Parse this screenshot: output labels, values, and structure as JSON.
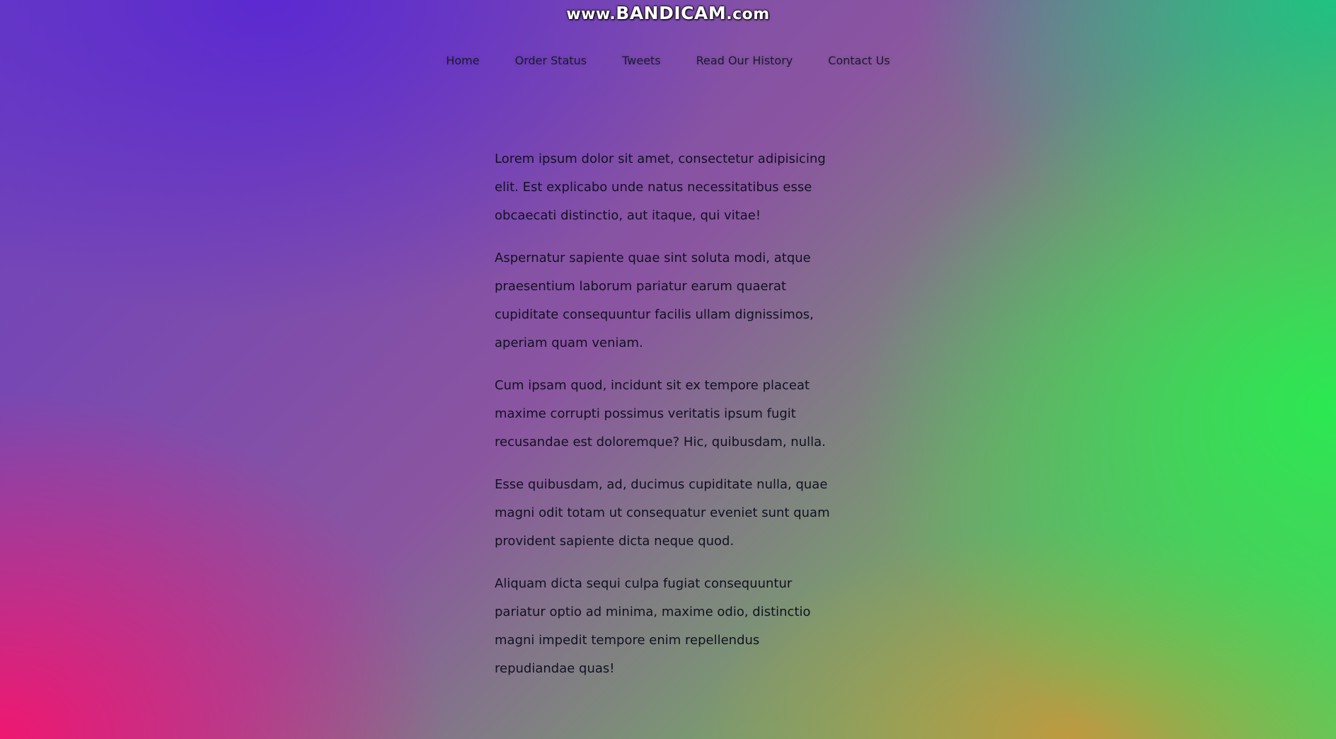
{
  "watermark": {
    "prefix": "www.",
    "brand": "BANDICAM",
    "suffix": ".com"
  },
  "nav": {
    "items": [
      {
        "label": "Home"
      },
      {
        "label": "Order Status"
      },
      {
        "label": "Tweets"
      },
      {
        "label": "Read Our History"
      },
      {
        "label": "Contact Us"
      }
    ]
  },
  "content": {
    "paragraphs": [
      "Lorem ipsum dolor sit amet, consectetur adipisicing elit. Est explicabo unde natus necessitatibus esse obcaecati distinctio, aut itaque, qui vitae!",
      "Aspernatur sapiente quae sint soluta modi, atque praesentium laborum pariatur earum quaerat cupiditate consequuntur facilis ullam dignissimos, aperiam quam veniam.",
      "Cum ipsam quod, incidunt sit ex tempore placeat maxime corrupti possimus veritatis ipsum fugit recusandae est doloremque? Hic, quibusdam, nulla.",
      "Esse quibusdam, ad, ducimus cupiditate nulla, quae magni odit totam ut consequatur eveniet sunt quam provident sapiente dicta neque quod.",
      "Aliquam dicta sequi culpa fugiat consequuntur pariatur optio ad minima, maxime odio, distinctio magni impedit tempore enim repellendus repudiandae quas!"
    ]
  },
  "colors": {
    "gradient_top_left": "#5a28d2",
    "gradient_bottom_left": "#f5146e",
    "gradient_right": "#28eb50",
    "gradient_bottom_center": "#c8963c",
    "text": "#111122"
  }
}
